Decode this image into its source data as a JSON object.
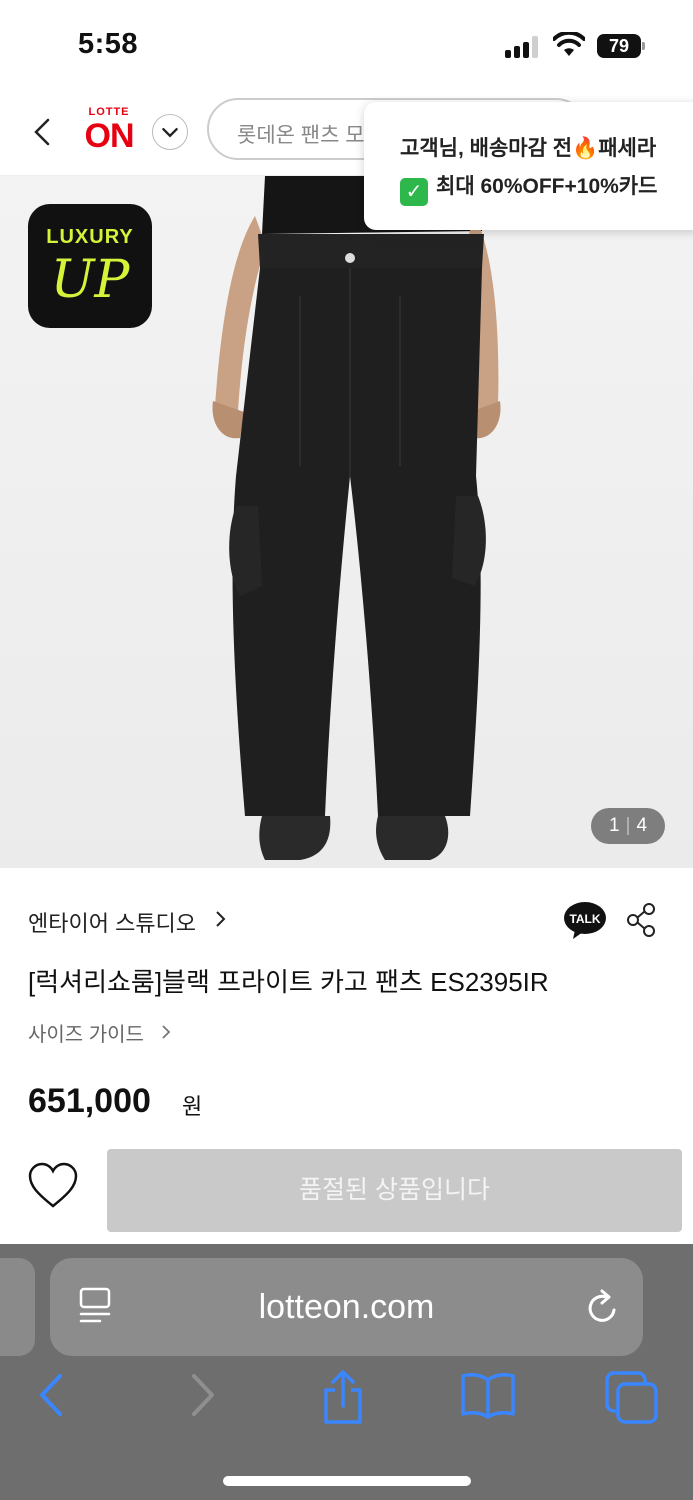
{
  "status_bar": {
    "time": "5:58",
    "battery": "79"
  },
  "header": {
    "logo_top": "LOTTE",
    "logo_bottom": "ON",
    "search_placeholder": "롯데온 팬츠 모"
  },
  "promo": {
    "line1": "고객님, 배송마감 전🔥패세라",
    "line2": "최대 60%OFF+10%카드"
  },
  "product_image": {
    "badge_line1": "LUXURY",
    "badge_line2": "UP",
    "counter_current": "1",
    "counter_total": "4"
  },
  "product": {
    "brand": "엔타이어 스튜디오",
    "title": "[럭셔리쇼룸]블랙 프라이트 카고 팬츠 ES2395IR",
    "size_guide": "사이즈 가이드",
    "price": "651,000",
    "price_unit": "원",
    "talk_label": "TALK"
  },
  "actions": {
    "soldout_label": "품절된 상품입니다"
  },
  "browser": {
    "url": "lotteon.com"
  },
  "colors": {
    "brand_red": "#e60012",
    "luxury_yellow": "#d6f33a",
    "safari_blue": "#3a86ff"
  }
}
